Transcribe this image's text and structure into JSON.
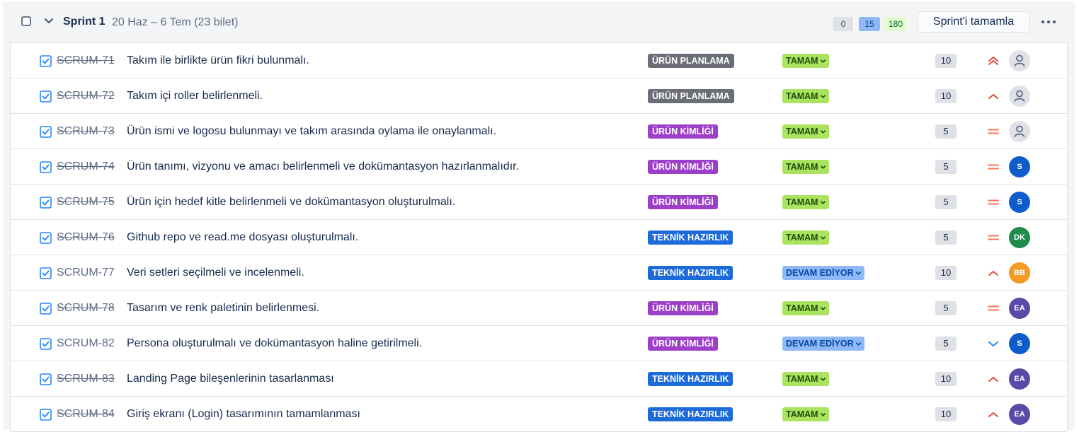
{
  "sprint": {
    "title": "Sprint 1",
    "meta": "20 Haz – 6 Tem (23 bilet)",
    "counts": {
      "todo": "0",
      "in_progress": "15",
      "done": "180"
    },
    "complete_button": "Sprint'i tamamla",
    "colors": {
      "todo": "#dfe1e6",
      "in_progress": "#8fb8f6",
      "done": "#e3fcca"
    }
  },
  "epics": {
    "urun_planlama": {
      "label": "ÜRÜN PLANLAMA",
      "color": "#6b6e76"
    },
    "urun_kimligi": {
      "label": "ÜRÜN KİMLİĞİ",
      "color": "#9c3fc9"
    },
    "teknik": {
      "label": "TEKNİK HAZIRLIK",
      "color": "#1d6bd9"
    }
  },
  "statuses": {
    "done": {
      "label": "TAMAM",
      "bg": "#abe360",
      "fg": "#1f4d0a"
    },
    "in_progress": {
      "label": "DEVAM EDİYOR",
      "bg": "#8fb8f6",
      "fg": "#0747a6"
    }
  },
  "issues": [
    {
      "key": "SCRUM-71",
      "summary": "Takım ile birlikte ürün fikri bulunmalı.",
      "epic": "ÜRÜN PLANLAMA",
      "status": "TAMAM",
      "points": "10",
      "priority": "highest",
      "assignee": "",
      "done": true
    },
    {
      "key": "SCRUM-72",
      "summary": "Takım içi roller belirlenmeli.",
      "epic": "ÜRÜN PLANLAMA",
      "status": "TAMAM",
      "points": "10",
      "priority": "high",
      "assignee": "",
      "done": true
    },
    {
      "key": "SCRUM-73",
      "summary": "Ürün ismi ve logosu bulunmayı ve takım arasında oylama ile onaylanmalı.",
      "epic": "ÜRÜN KİMLİĞİ",
      "status": "TAMAM",
      "points": "5",
      "priority": "medium",
      "assignee": "",
      "done": true
    },
    {
      "key": "SCRUM-74",
      "summary": "Ürün tanımı, vizyonu ve amacı belirlenmeli ve dokümantasyon hazırlanmalıdır.",
      "epic": "ÜRÜN KİMLİĞİ",
      "status": "TAMAM",
      "points": "5",
      "priority": "medium",
      "assignee": "S",
      "avatar_color": "#0c5ccc",
      "done": true
    },
    {
      "key": "SCRUM-75",
      "summary": "Ürün için hedef kitle belirlenmeli ve dokümantasyon oluşturulmalı.",
      "epic": "ÜRÜN KİMLİĞİ",
      "status": "TAMAM",
      "points": "5",
      "priority": "medium",
      "assignee": "S",
      "avatar_color": "#0c5ccc",
      "done": true
    },
    {
      "key": "SCRUM-76",
      "summary": "Github repo ve read.me dosyası oluşturulmalı.",
      "epic": "TEKNİK HAZIRLIK",
      "status": "TAMAM",
      "points": "5",
      "priority": "medium",
      "assignee": "DK",
      "avatar_color": "#1f8b4d",
      "done": true
    },
    {
      "key": "SCRUM-77",
      "summary": "Veri setleri seçilmeli ve incelenmeli.",
      "epic": "TEKNİK HAZIRLIK",
      "status": "DEVAM EDİYOR",
      "points": "10",
      "priority": "high",
      "assignee": "BB",
      "avatar_color": "#f59a23",
      "done": false
    },
    {
      "key": "SCRUM-78",
      "summary": "Tasarım ve renk paletinin belirlenmesi.",
      "epic": "ÜRÜN KİMLİĞİ",
      "status": "TAMAM",
      "points": "5",
      "priority": "medium",
      "assignee": "EA",
      "avatar_color": "#5a4aa8",
      "done": true
    },
    {
      "key": "SCRUM-82",
      "summary": "Persona oluşturulmalı ve dokümantasyon haline getirilmeli.",
      "epic": "ÜRÜN KİMLİĞİ",
      "status": "DEVAM EDİYOR",
      "points": "5",
      "priority": "low",
      "assignee": "S",
      "avatar_color": "#0c5ccc",
      "done": false
    },
    {
      "key": "SCRUM-83",
      "summary": "Landing Page bileşenlerinin tasarlanması",
      "epic": "TEKNİK HAZIRLIK",
      "status": "TAMAM",
      "points": "10",
      "priority": "high",
      "assignee": "EA",
      "avatar_color": "#5a4aa8",
      "done": true
    },
    {
      "key": "SCRUM-84",
      "summary": "Giriş ekranı (Login) tasarımının tamamlanması",
      "epic": "TEKNİK HAZIRLIK",
      "status": "TAMAM",
      "points": "10",
      "priority": "high",
      "assignee": "EA",
      "avatar_color": "#5a4aa8",
      "done": true
    }
  ]
}
